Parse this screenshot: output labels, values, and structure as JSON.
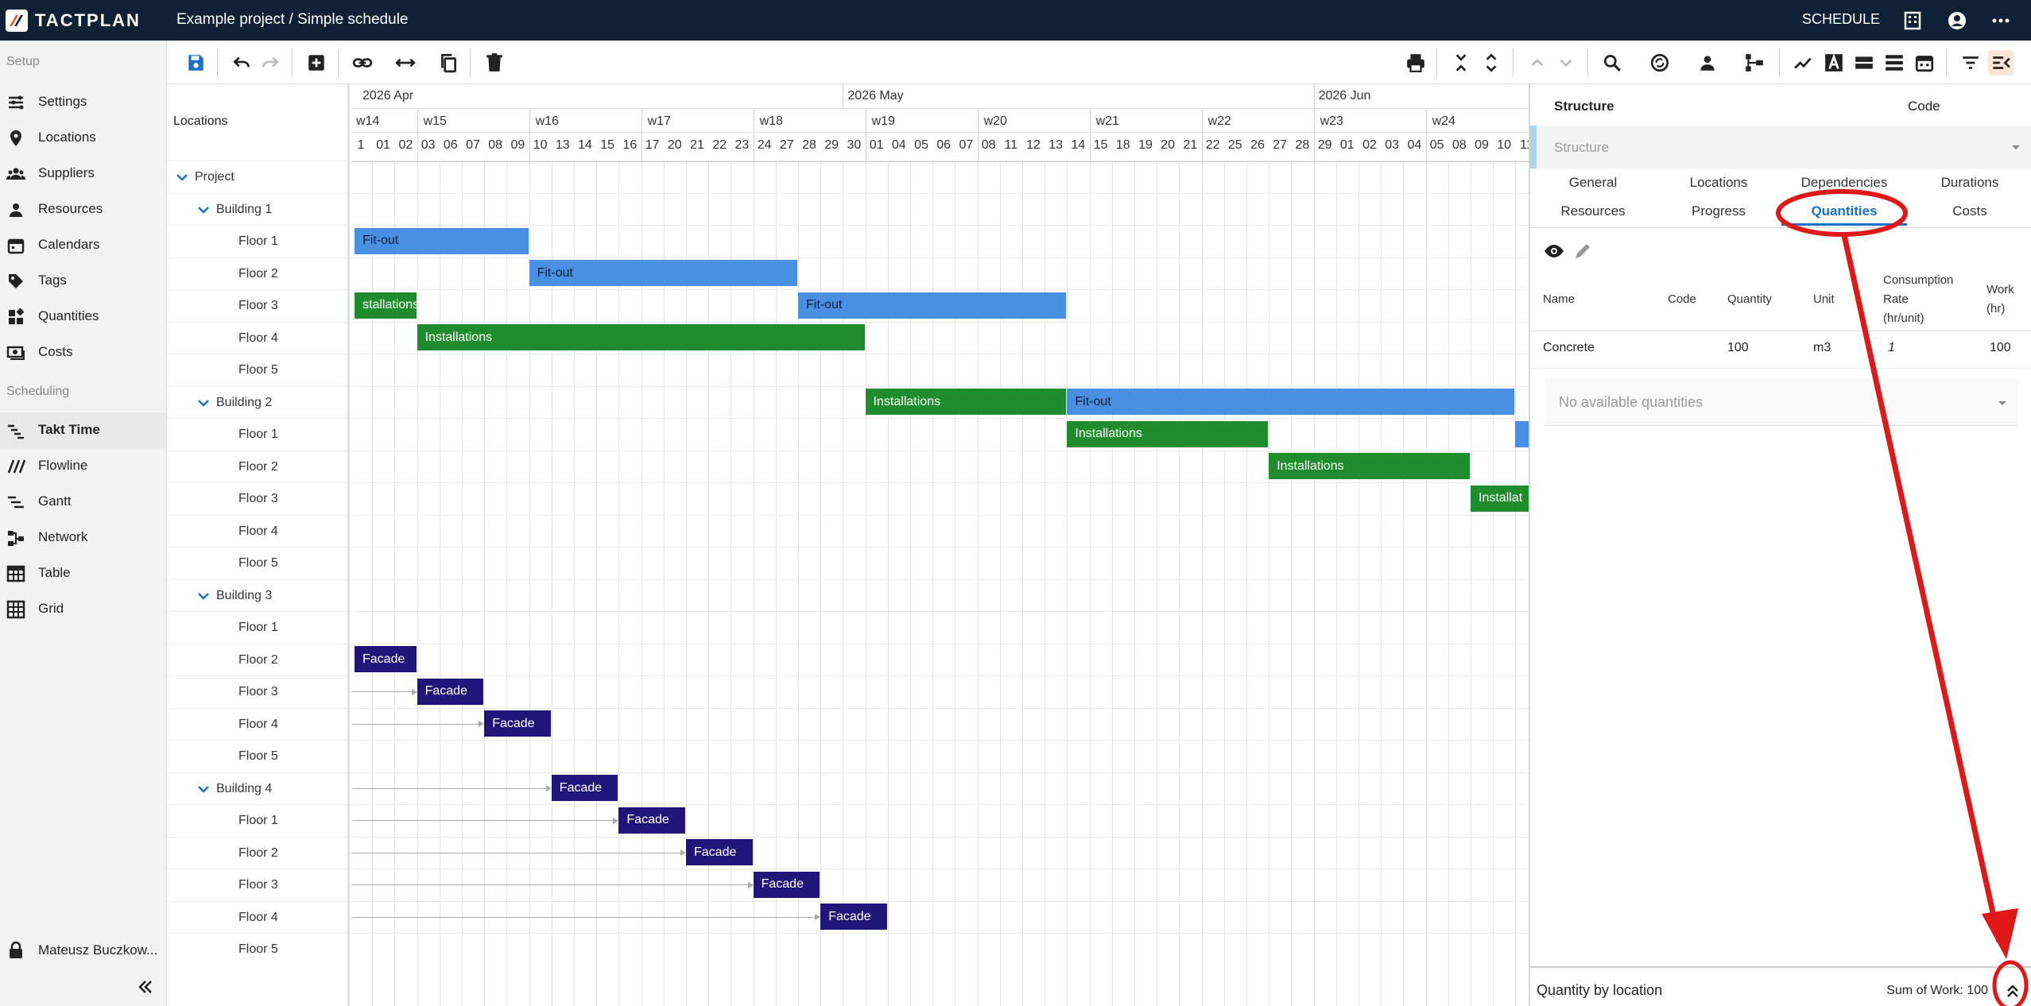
{
  "topbar": {
    "brand": "TACTPLAN",
    "breadcrumb": "Example project / Simple schedule",
    "mode": "SCHEDULE"
  },
  "sidebar": {
    "setup_label": "Setup",
    "setup_items": [
      "Settings",
      "Locations",
      "Suppliers",
      "Resources",
      "Calendars",
      "Tags",
      "Quantities",
      "Costs"
    ],
    "scheduling_label": "Scheduling",
    "scheduling_items": [
      "Takt Time",
      "Flowline",
      "Gantt",
      "Network",
      "Table",
      "Grid"
    ],
    "active_item": "Takt Time",
    "user": "Mateusz Buczkow..."
  },
  "locations": {
    "header": "Locations",
    "rows": [
      {
        "label": "Project",
        "level": 0,
        "group": true
      },
      {
        "label": "Building 1",
        "level": 1,
        "group": true
      },
      {
        "label": "Floor 1",
        "level": 2
      },
      {
        "label": "Floor 2",
        "level": 2
      },
      {
        "label": "Floor 3",
        "level": 2
      },
      {
        "label": "Floor 4",
        "level": 2
      },
      {
        "label": "Floor 5",
        "level": 2
      },
      {
        "label": "Building 2",
        "level": 1,
        "group": true
      },
      {
        "label": "Floor 1",
        "level": 2
      },
      {
        "label": "Floor 2",
        "level": 2
      },
      {
        "label": "Floor 3",
        "level": 2
      },
      {
        "label": "Floor 4",
        "level": 2
      },
      {
        "label": "Floor 5",
        "level": 2
      },
      {
        "label": "Building 3",
        "level": 1,
        "group": true
      },
      {
        "label": "Floor 1",
        "level": 2
      },
      {
        "label": "Floor 2",
        "level": 2
      },
      {
        "label": "Floor 3",
        "level": 2
      },
      {
        "label": "Floor 4",
        "level": 2
      },
      {
        "label": "Floor 5",
        "level": 2
      },
      {
        "label": "Building 4",
        "level": 1,
        "group": true
      },
      {
        "label": "Floor 1",
        "level": 2
      },
      {
        "label": "Floor 2",
        "level": 2
      },
      {
        "label": "Floor 3",
        "level": 2
      },
      {
        "label": "Floor 4",
        "level": 2
      },
      {
        "label": "Floor 5",
        "level": 2
      }
    ]
  },
  "timeline": {
    "months": [
      {
        "label": "2026 Apr",
        "day_index": 0
      },
      {
        "label": "2026 May",
        "day_index": 22
      },
      {
        "label": "2026 Jun",
        "day_index": 43
      }
    ],
    "weeks": [
      {
        "label": "w14",
        "day_index": 0
      },
      {
        "label": "w15",
        "day_index": 3
      },
      {
        "label": "w16",
        "day_index": 8
      },
      {
        "label": "w17",
        "day_index": 13
      },
      {
        "label": "w18",
        "day_index": 18
      },
      {
        "label": "w19",
        "day_index": 23
      },
      {
        "label": "w20",
        "day_index": 28
      },
      {
        "label": "w21",
        "day_index": 33
      },
      {
        "label": "w22",
        "day_index": 38
      },
      {
        "label": "w23",
        "day_index": 43
      },
      {
        "label": "w24",
        "day_index": 48
      }
    ],
    "days": [
      "1",
      "01",
      "02",
      "03",
      "06",
      "07",
      "08",
      "09",
      "10",
      "13",
      "14",
      "15",
      "16",
      "17",
      "20",
      "21",
      "22",
      "23",
      "24",
      "27",
      "28",
      "29",
      "30",
      "01",
      "04",
      "05",
      "06",
      "07",
      "08",
      "11",
      "12",
      "13",
      "14",
      "15",
      "18",
      "19",
      "20",
      "21",
      "22",
      "25",
      "26",
      "27",
      "28",
      "29",
      "01",
      "02",
      "03",
      "04",
      "05",
      "08",
      "09",
      "10",
      "11"
    ],
    "tasks": [
      {
        "row": 3,
        "start": 0,
        "end": 8,
        "label": "Fit-out",
        "type": "blue"
      },
      {
        "row": 4,
        "start": 8,
        "end": 20,
        "label": "Fit-out",
        "type": "blue"
      },
      {
        "row": 5,
        "start": 0,
        "end": 3,
        "label": "stallations",
        "type": "green"
      },
      {
        "row": 5,
        "start": 20,
        "end": 32,
        "label": "Fit-out",
        "type": "blue"
      },
      {
        "row": 6,
        "start": 3,
        "end": 23,
        "label": "Installations",
        "type": "green"
      },
      {
        "row": 8,
        "start": 23,
        "end": 32,
        "label": "Installations",
        "type": "green"
      },
      {
        "row": 8,
        "start": 32,
        "end": 52,
        "label": "Fit-out",
        "type": "blue"
      },
      {
        "row": 9,
        "start": 32,
        "end": 41,
        "label": "Installations",
        "type": "green"
      },
      {
        "row": 9,
        "start": 52,
        "end": 54,
        "label": "",
        "type": "blue"
      },
      {
        "row": 10,
        "start": 41,
        "end": 50,
        "label": "Installations",
        "type": "green"
      },
      {
        "row": 11,
        "start": 50,
        "end": 54,
        "label": "Installat",
        "type": "green"
      },
      {
        "row": 16,
        "start": 0,
        "end": 3,
        "label": "Facade",
        "type": "navy"
      },
      {
        "row": 17,
        "start": 3,
        "end": 6,
        "label": "Facade",
        "type": "navy"
      },
      {
        "row": 18,
        "start": 6,
        "end": 9,
        "label": "Facade",
        "type": "navy"
      },
      {
        "row": 20,
        "start": 9,
        "end": 12,
        "label": "Facade",
        "type": "navy"
      },
      {
        "row": 21,
        "start": 12,
        "end": 15,
        "label": "Facade",
        "type": "navy"
      },
      {
        "row": 22,
        "start": 15,
        "end": 18,
        "label": "Facade",
        "type": "navy"
      },
      {
        "row": 23,
        "start": 18,
        "end": 21,
        "label": "Facade",
        "type": "navy"
      },
      {
        "row": 24,
        "start": 21,
        "end": 24,
        "label": "Facade",
        "type": "navy"
      }
    ]
  },
  "panel": {
    "header_structure": "Structure",
    "header_code": "Code",
    "select_placeholder": "Structure",
    "tabs_row1": [
      "General",
      "Locations",
      "Dependencies",
      "Durations"
    ],
    "tabs_row2": [
      "Resources",
      "Progress",
      "Quantities",
      "Costs"
    ],
    "active_tab": "Quantities",
    "columns": {
      "name": "Name",
      "code": "Code",
      "quantity": "Quantity",
      "unit": "Unit",
      "rate_1": "Consumption",
      "rate_2": "Rate",
      "rate_3": "(hr/unit)",
      "work_1": "Work",
      "work_2": "(hr)"
    },
    "row": {
      "name": "Concrete",
      "code": "",
      "quantity": "100",
      "unit": "m3",
      "rate": "1",
      "work": "100"
    },
    "no_quantities": "No available quantities",
    "footer_label": "Quantity by location",
    "footer_sum": "Sum of Work: 100"
  },
  "colors": {
    "topbar": "#0f2135",
    "fitout": "#4a90e2",
    "installations": "#1f8c2e",
    "facade": "#22157a",
    "active_tab": "#1a6fc7",
    "annotation": "#e01818"
  }
}
